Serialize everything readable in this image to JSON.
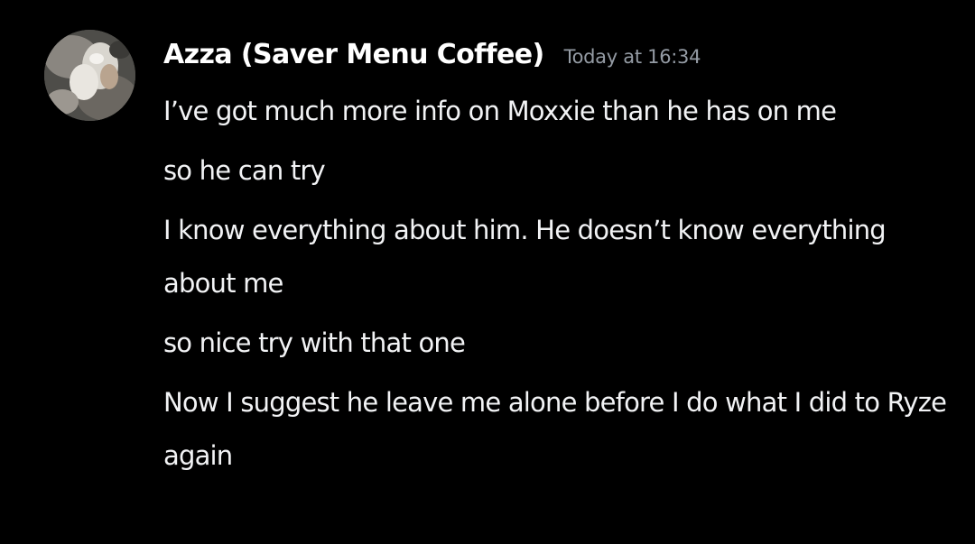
{
  "message": {
    "author": "Azza (Saver Menu Coffee)",
    "timestamp": "Today at 16:34",
    "avatar_icon": "user-avatar-photo",
    "lines": [
      "I’ve got much more info on Moxxie than he has on me",
      "so he can try",
      "I know everything about him. He doesn’t know everything about me",
      "so nice try with that one",
      "Now I suggest he leave me alone before I do what I did to Ryze again"
    ]
  },
  "colors": {
    "background": "#000000",
    "username": "#ffffff",
    "timestamp": "#949ba4",
    "text": "#f2f3f5"
  }
}
